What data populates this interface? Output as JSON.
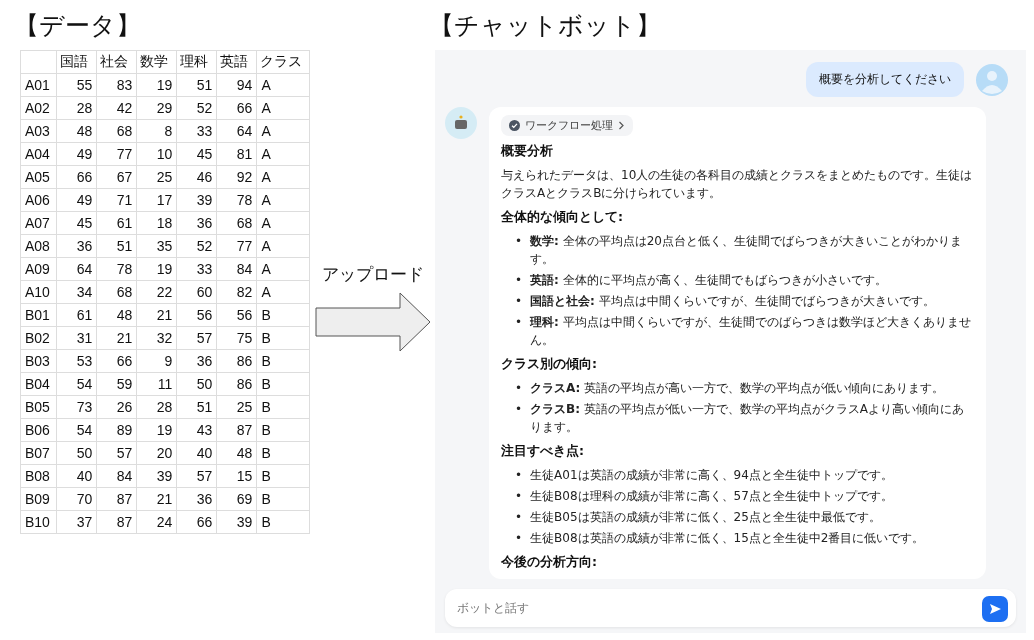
{
  "data_title": "【データ】",
  "table": {
    "columns": [
      "",
      "国語",
      "社会",
      "数学",
      "理科",
      "英語",
      "クラス"
    ],
    "rows": [
      [
        "A01",
        "55",
        "83",
        "19",
        "51",
        "94",
        "A"
      ],
      [
        "A02",
        "28",
        "42",
        "29",
        "52",
        "66",
        "A"
      ],
      [
        "A03",
        "48",
        "68",
        "8",
        "33",
        "64",
        "A"
      ],
      [
        "A04",
        "49",
        "77",
        "10",
        "45",
        "81",
        "A"
      ],
      [
        "A05",
        "66",
        "67",
        "25",
        "46",
        "92",
        "A"
      ],
      [
        "A06",
        "49",
        "71",
        "17",
        "39",
        "78",
        "A"
      ],
      [
        "A07",
        "45",
        "61",
        "18",
        "36",
        "68",
        "A"
      ],
      [
        "A08",
        "36",
        "51",
        "35",
        "52",
        "77",
        "A"
      ],
      [
        "A09",
        "64",
        "78",
        "19",
        "33",
        "84",
        "A"
      ],
      [
        "A10",
        "34",
        "68",
        "22",
        "60",
        "82",
        "A"
      ],
      [
        "B01",
        "61",
        "48",
        "21",
        "56",
        "56",
        "B"
      ],
      [
        "B02",
        "31",
        "21",
        "32",
        "57",
        "75",
        "B"
      ],
      [
        "B03",
        "53",
        "66",
        "9",
        "36",
        "86",
        "B"
      ],
      [
        "B04",
        "54",
        "59",
        "11",
        "50",
        "86",
        "B"
      ],
      [
        "B05",
        "73",
        "26",
        "28",
        "51",
        "25",
        "B"
      ],
      [
        "B06",
        "54",
        "89",
        "19",
        "43",
        "87",
        "B"
      ],
      [
        "B07",
        "50",
        "57",
        "20",
        "40",
        "48",
        "B"
      ],
      [
        "B08",
        "40",
        "84",
        "39",
        "57",
        "15",
        "B"
      ],
      [
        "B09",
        "70",
        "87",
        "21",
        "36",
        "69",
        "B"
      ],
      [
        "B10",
        "37",
        "87",
        "24",
        "66",
        "39",
        "B"
      ]
    ]
  },
  "upload_label": "アップロード",
  "chat_title": "【チャットボット】",
  "chat": {
    "user_message": "概要を分析してください",
    "workflow_label": "ワークフロー処理",
    "heading": "概要分析",
    "intro": "与えられたデータは、10人の生徒の各科目の成績とクラスをまとめたものです。生徒はクラスAとクラスBに分けられています。",
    "sections": [
      {
        "heading": "全体的な傾向として:",
        "items": [
          "**数学:** 全体の平均点は20点台と低く、生徒間でばらつきが大きいことがわかります。",
          "**英語:** 全体的に平均点が高く、生徒間でもばらつきが小さいです。",
          "**国語と社会:** 平均点は中間くらいですが、生徒間でばらつきが大きいです。",
          "**理科:** 平均点は中間くらいですが、生徒間でのばらつきは数学ほど大きくありません。"
        ]
      },
      {
        "heading": "クラス別の傾向:",
        "items": [
          "**クラスA:** 英語の平均点が高い一方で、数学の平均点が低い傾向にあります。",
          "**クラスB:** 英語の平均点が低い一方で、数学の平均点がクラスAより高い傾向にあります。"
        ]
      },
      {
        "heading": "注目すべき点:",
        "items": [
          "生徒A01は英語の成績が非常に高く、94点と全生徒中トップです。",
          "生徒B08は理科の成績が非常に高く、57点と全生徒中トップです。",
          "生徒B05は英語の成績が非常に低く、25点と全生徒中最低です。",
          "生徒B08は英語の成績が非常に低く、15点と全生徒中2番目に低いです。"
        ]
      },
      {
        "heading": "今後の分析方向:"
      }
    ],
    "bullet": "•"
  },
  "input": {
    "placeholder": "ボットと話す"
  }
}
